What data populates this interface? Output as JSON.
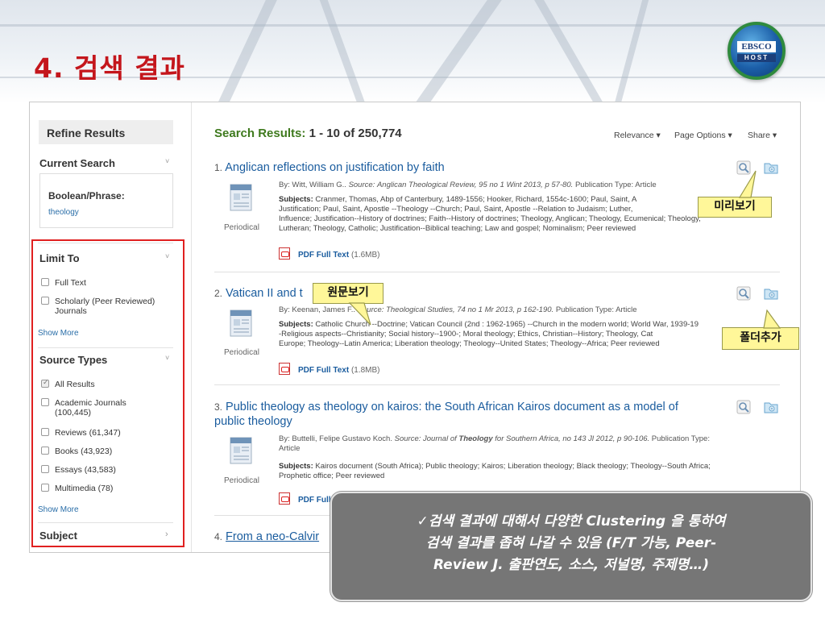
{
  "page": {
    "title": "4. 검색 결과",
    "logo": {
      "line1": "EBSCO",
      "line2": "HOST"
    }
  },
  "sidebar": {
    "refine_title": "Refine Results",
    "current_search": {
      "label": "Current Search",
      "type_label": "Boolean/Phrase:",
      "value": "theology"
    },
    "limit_to": {
      "label": "Limit To",
      "options": [
        {
          "label": "Full Text",
          "checked": false
        },
        {
          "label": "Scholarly (Peer Reviewed) Journals",
          "checked": false
        }
      ],
      "show_more": "Show More"
    },
    "source_types": {
      "label": "Source Types",
      "options": [
        {
          "label": "All Results",
          "checked": true
        },
        {
          "label": "Academic Journals (100,445)",
          "checked": false
        },
        {
          "label": "Reviews (61,347)",
          "checked": false
        },
        {
          "label": "Books (43,923)",
          "checked": false
        },
        {
          "label": "Essays (43,583)",
          "checked": false
        },
        {
          "label": "Multimedia (78)",
          "checked": false
        }
      ],
      "show_more": "Show More"
    },
    "subject": {
      "label": "Subject"
    }
  },
  "results": {
    "heading": "Search Results:",
    "count": "1 - 10 of 250,774",
    "options": {
      "relevance": "Relevance ▾",
      "page_options": "Page Options ▾",
      "share": "Share ▾"
    },
    "items": [
      {
        "num": "1.",
        "title": "Anglican reflections on justification by faith",
        "by": "By: Witt, William G..",
        "source_label": "Source:",
        "source": "Anglican Theological Review, 95 no 1 Wint 2013, p 57-80.",
        "pub_type": "Publication Type: Article",
        "subjects_label": "Subjects:",
        "subjects_l1": "Cranmer, Thomas, Abp of Canterbury, 1489-1556; Hooker, Richard, 1554c-1600; Paul, Saint, A",
        "subjects_l2": "Justification; Paul, Saint, Apostle --Theology --Church; Paul, Saint, Apostle --Relation to Judaism; Luther,",
        "subjects_l3": "Influence; Justification--History of doctrines; Faith--History of doctrines; Theology, Anglican; Theology, Ecumenical; Theology,",
        "subjects_l4": "Lutheran; Theology, Catholic; Justification--Biblical teaching; Law and gospel; Nominalism; Peer reviewed",
        "pub_label": "Periodical",
        "pdf_label": "PDF Full Text",
        "pdf_size": "(1.6MB)"
      },
      {
        "num": "2.",
        "title_a": "Vatican II and t",
        "title_b": "ics",
        "by": "By: Keenan, James F..",
        "source_label": "Source:",
        "source": "Theological Studies, 74 no 1 Mr 2013, p 162-190.",
        "pub_type": "Publication Type: Article",
        "subjects_label": "Subjects:",
        "subjects_l1": "Catholic Church --Doctrine; Vatican Council (2nd : 1962-1965) --Church in the modern world; World War, 1939-19",
        "subjects_l2": "-Religious aspects--Christianity; Social history--1900-; Moral theology; Ethics, Christian--History; Theology, Cat",
        "subjects_l3": "Europe; Theology--Latin America; Liberation theology; Theology--United States; Theology--Africa; Peer reviewed",
        "pub_label": "Periodical",
        "pdf_label": "PDF Full Text",
        "pdf_size": "(1.8MB)"
      },
      {
        "num": "3.",
        "title_l1": "Public theology as theology on kairos: the South African Kairos document as a model of",
        "title_l2": "public theology",
        "by": "By: Buttelli, Felipe Gustavo Koch.",
        "source_label": "Source:",
        "source_pre": "Journal of",
        "source_bold": "Theology",
        "source_post": "for Southern Africa, no 143 Jl 2012, p 90-106.",
        "pub_type": "Publication Type:",
        "pub_type_l2": "Article",
        "subjects_label": "Subjects:",
        "subjects_l1": "Kairos document (South Africa); Public theology; Kairos; Liberation theology; Black theology; Theology--South Africa;",
        "subjects_l2": "Prophetic office; Peer reviewed",
        "pub_label": "Periodical",
        "pdf_label": "PDF Full"
      },
      {
        "num": "4.",
        "title": "From a neo-Calvir"
      }
    ]
  },
  "callouts": {
    "preview": "미리보기",
    "fulltext": "원문보기",
    "folder": "폴더추가"
  },
  "info": {
    "line1": "✓검색 결과에 대해서 다양한 Clustering 을 통하여",
    "line2": "검색 결과를 좁혀 나갈 수 있음 (F/T 가능, Peer-",
    "line3": "Review J. 출판연도, 소스, 저널명, 주제명…)"
  }
}
